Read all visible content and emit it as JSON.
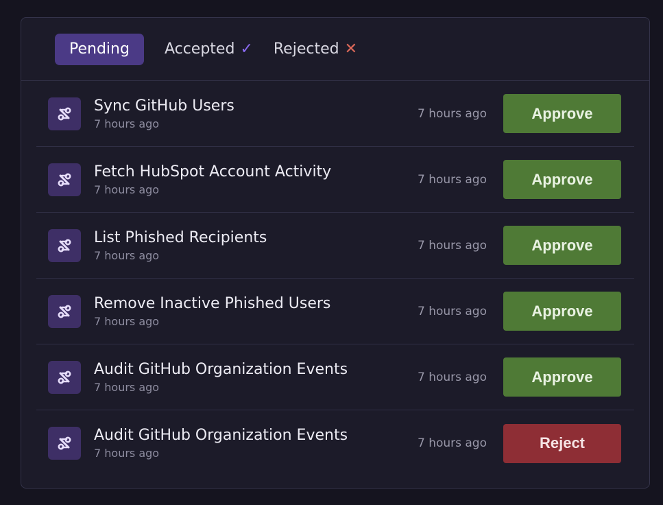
{
  "tabs": [
    {
      "label": "Pending",
      "active": true,
      "mark": ""
    },
    {
      "label": "Accepted",
      "active": false,
      "mark": "✓"
    },
    {
      "label": "Rejected",
      "active": false,
      "mark": "✕"
    }
  ],
  "icon": "workflow-icon",
  "items": [
    {
      "title": "Sync GitHub Users",
      "subtitle": "7 hours ago",
      "time": "7 hours ago",
      "action": "Approve"
    },
    {
      "title": "Fetch HubSpot Account Activity",
      "subtitle": "7 hours ago",
      "time": "7 hours ago",
      "action": "Approve"
    },
    {
      "title": "List Phished Recipients",
      "subtitle": "7 hours ago",
      "time": "7 hours ago",
      "action": "Approve"
    },
    {
      "title": "Remove Inactive Phished Users",
      "subtitle": "7 hours ago",
      "time": "7 hours ago",
      "action": "Approve"
    },
    {
      "title": "Audit GitHub Organization Events",
      "subtitle": "7 hours ago",
      "time": "7 hours ago",
      "action": "Approve"
    },
    {
      "title": "Audit GitHub Organization Events",
      "subtitle": "7 hours ago",
      "time": "7 hours ago",
      "action": "Reject"
    }
  ],
  "colors": {
    "approve": "#4f7a36",
    "reject": "#8e2e35",
    "active_tab": "#4b3a86",
    "check": "#8b6bf2",
    "x": "#e06a5a"
  }
}
